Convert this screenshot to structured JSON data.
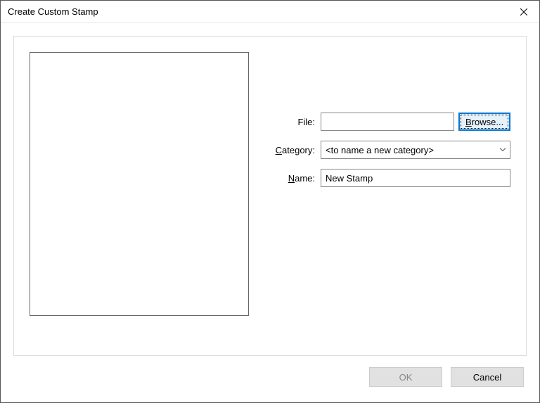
{
  "titlebar": {
    "title": "Create Custom Stamp"
  },
  "form": {
    "file_label": "File:",
    "file_value": "",
    "browse_label": "Browse...",
    "category_label_pre": "C",
    "category_label_post": "ategory:",
    "category_value": "<to name a new category>",
    "name_label_pre": "N",
    "name_label_post": "ame:",
    "name_value": "New Stamp"
  },
  "buttons": {
    "ok": "OK",
    "cancel": "Cancel"
  }
}
